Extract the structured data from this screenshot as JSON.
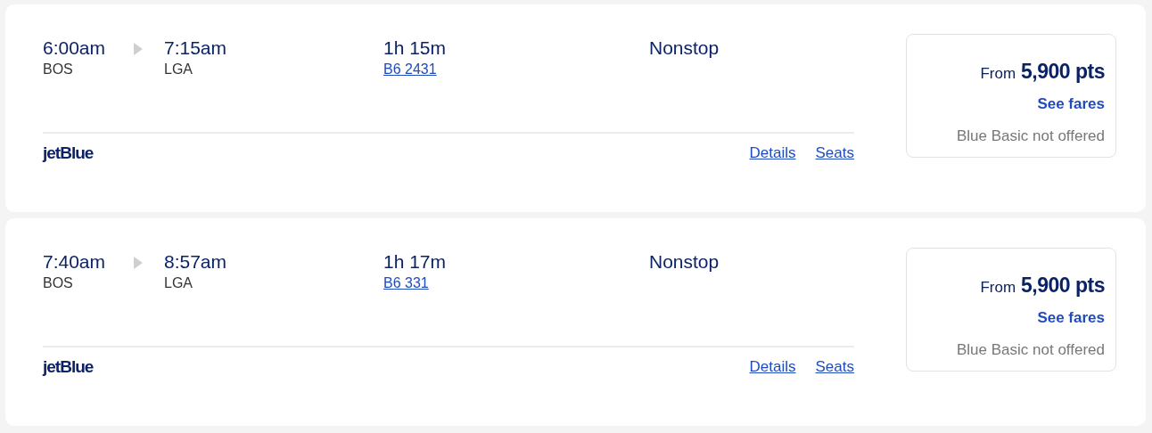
{
  "flights": [
    {
      "depart_time": "6:00am",
      "depart_airport": "BOS",
      "arrive_time": "7:15am",
      "arrive_airport": "LGA",
      "duration": "1h 15m",
      "flight_number": "B6 2431",
      "stops": "Nonstop",
      "airline": "jetBlue",
      "links": [
        "Details",
        "Seats"
      ],
      "price_prefix": "From",
      "price": "5,900 pts",
      "fares_link": "See fares",
      "fare_note": "Blue Basic not offered"
    },
    {
      "depart_time": "7:40am",
      "depart_airport": "BOS",
      "arrive_time": "8:57am",
      "arrive_airport": "LGA",
      "duration": "1h 17m",
      "flight_number": "B6 331",
      "stops": "Nonstop",
      "airline": "jetBlue",
      "links": [
        "Details",
        "Seats"
      ],
      "price_prefix": "From",
      "price": "5,900 pts",
      "fares_link": "See fares",
      "fare_note": "Blue Basic not offered"
    }
  ]
}
